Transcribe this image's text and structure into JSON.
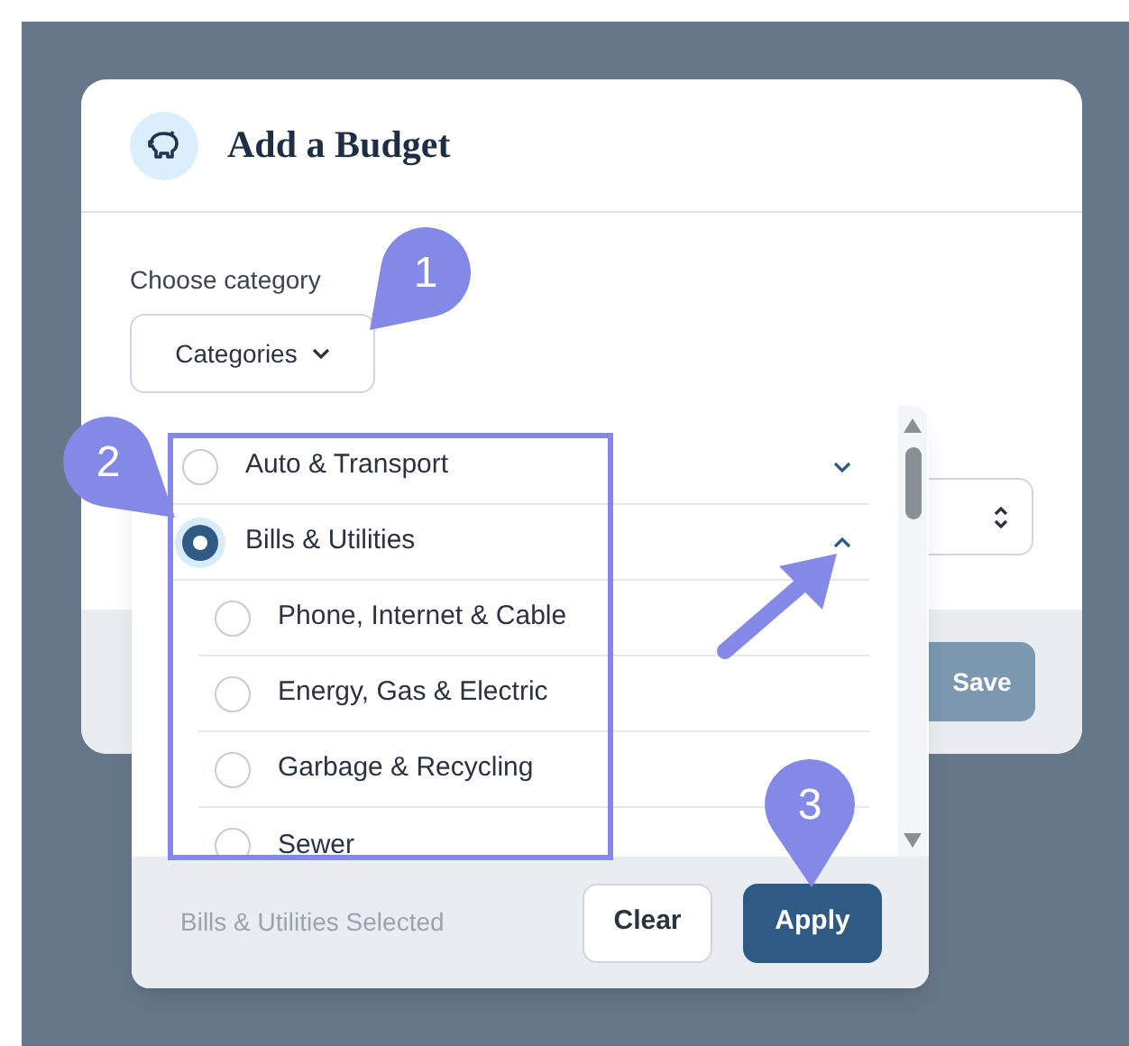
{
  "dialog": {
    "title": "Add a Budget",
    "label": "Choose category",
    "dropdown_button": "Categories",
    "footer_button": "Save"
  },
  "menu": {
    "items": [
      {
        "label": "Auto & Transport",
        "selected": false,
        "expanded": false
      },
      {
        "label": "Bills & Utilities",
        "selected": true,
        "expanded": true,
        "children": [
          {
            "label": "Phone, Internet & Cable",
            "selected": false
          },
          {
            "label": "Energy, Gas & Electric",
            "selected": false
          },
          {
            "label": "Garbage & Recycling",
            "selected": false
          },
          {
            "label": "Sewer",
            "selected": false
          }
        ]
      }
    ],
    "status": "Bills & Utilities Selected",
    "buttons": [
      {
        "label": "Clear",
        "kind": "secondary"
      },
      {
        "label": "Apply",
        "kind": "primary"
      }
    ]
  },
  "annotations": [
    {
      "label": "1"
    },
    {
      "label": "2"
    },
    {
      "label": "3"
    }
  ]
}
